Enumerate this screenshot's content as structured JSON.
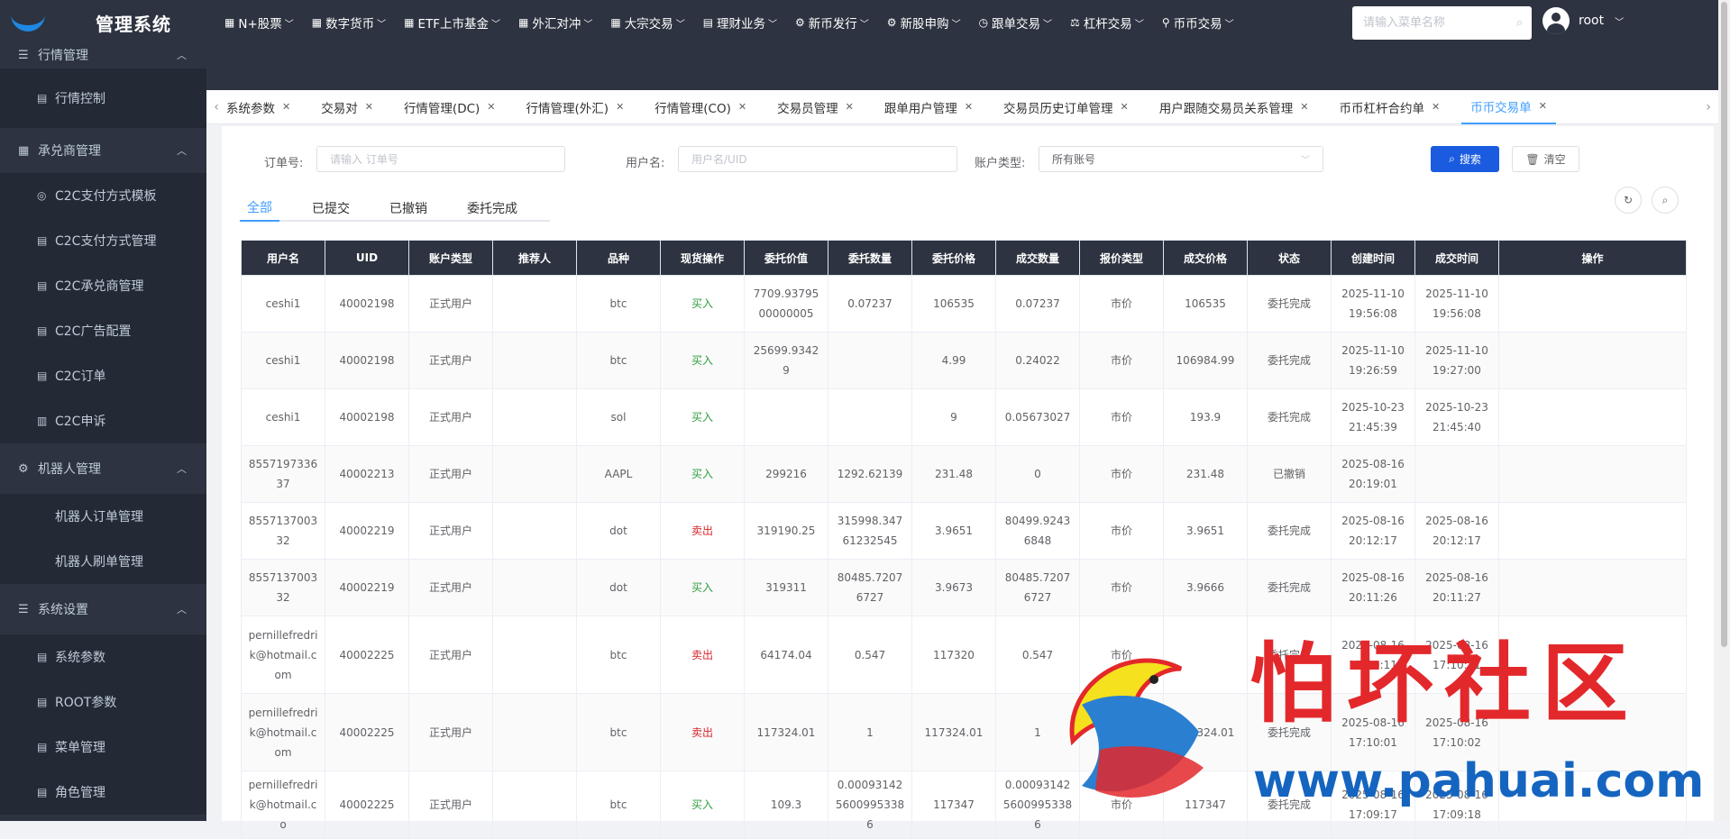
{
  "app": {
    "title": "管理系统"
  },
  "sidebar": {
    "groups": [
      {
        "label": "行情管理",
        "icon": "list-icon",
        "items": [
          {
            "label": "行情控制",
            "icon": "doc-icon"
          }
        ]
      },
      {
        "label": "承兑商管理",
        "icon": "table-icon",
        "items": [
          {
            "label": "C2C支付方式模板",
            "icon": "circle-icon"
          },
          {
            "label": "C2C支付方式管理",
            "icon": "doc-icon"
          },
          {
            "label": "C2C承兑商管理",
            "icon": "doc-icon"
          },
          {
            "label": "C2C广告配置",
            "icon": "doc-icon"
          },
          {
            "label": "C2C订单",
            "icon": "doc-icon"
          },
          {
            "label": "C2C申诉",
            "icon": "chart-icon"
          }
        ]
      },
      {
        "label": "机器人管理",
        "icon": "gear-icon",
        "items": [
          {
            "label": "机器人订单管理",
            "icon": ""
          },
          {
            "label": "机器人刷单管理",
            "icon": ""
          }
        ]
      },
      {
        "label": "系统设置",
        "icon": "list-icon",
        "items": [
          {
            "label": "系统参数",
            "icon": "doc-icon"
          },
          {
            "label": "ROOT参数",
            "icon": "doc-icon"
          },
          {
            "label": "菜单管理",
            "icon": "doc-icon"
          },
          {
            "label": "角色管理",
            "icon": "doc-icon"
          }
        ]
      }
    ]
  },
  "topnav": {
    "items": [
      {
        "label": "N+股票",
        "icon": "grid-icon"
      },
      {
        "label": "数字货币",
        "icon": "grid-icon"
      },
      {
        "label": "ETF上市基金",
        "icon": "grid-icon"
      },
      {
        "label": "外汇对冲",
        "icon": "grid-icon"
      },
      {
        "label": "大宗交易",
        "icon": "grid-icon"
      },
      {
        "label": "理财业务",
        "icon": "table-icon"
      },
      {
        "label": "新币发行",
        "icon": "gear-icon"
      },
      {
        "label": "新股申购",
        "icon": "gear-icon"
      },
      {
        "label": "跟单交易",
        "icon": "clock-icon"
      },
      {
        "label": "杠杆交易",
        "icon": "scale-icon"
      },
      {
        "label": "币币交易",
        "icon": "pin-icon"
      }
    ],
    "search_placeholder": "请输入菜单名称",
    "user_name": "root"
  },
  "tabs": [
    {
      "label": "系统参数"
    },
    {
      "label": "交易对"
    },
    {
      "label": "行情管理(DC)"
    },
    {
      "label": "行情管理(外汇)"
    },
    {
      "label": "行情管理(CO)"
    },
    {
      "label": "交易员管理"
    },
    {
      "label": "跟单用户管理"
    },
    {
      "label": "交易员历史订单管理"
    },
    {
      "label": "用户跟随交易员关系管理"
    },
    {
      "label": "币币杠杆合约单"
    },
    {
      "label": "币币交易单",
      "active": true
    }
  ],
  "filters": {
    "order_label": "订单号:",
    "order_placeholder": "请输入 订单号",
    "user_label": "用户名:",
    "user_placeholder": "用户名/UID",
    "account_label": "账户类型:",
    "account_value": "所有账号",
    "search_button": "搜索",
    "clear_button": "清空"
  },
  "status_tabs": [
    {
      "label": "全部",
      "active": true
    },
    {
      "label": "已提交"
    },
    {
      "label": "已撤销"
    },
    {
      "label": "委托完成"
    }
  ],
  "table": {
    "headers": [
      "用户名",
      "UID",
      "账户类型",
      "推荐人",
      "品种",
      "现货操作",
      "委托价值",
      "委托数量",
      "委托价格",
      "成交数量",
      "报价类型",
      "成交价格",
      "状态",
      "创建时间",
      "成交时间",
      "操作"
    ],
    "rows": [
      [
        "ceshi1",
        "40002198",
        "正式用户",
        "",
        "btc",
        "买入",
        "7709.9379500000005",
        "0.07237",
        "106535",
        "0.07237",
        "市价",
        "106535",
        "委托完成",
        "2025-11-10 19:56:08",
        "2025-11-10 19:56:08",
        ""
      ],
      [
        "ceshi1",
        "40002198",
        "正式用户",
        "",
        "btc",
        "买入",
        "25699.93429",
        "",
        "4.99",
        "0.24022",
        "市价",
        "106984.99",
        "委托完成",
        "2025-11-10 19:26:59",
        "2025-11-10 19:27:00",
        ""
      ],
      [
        "ceshi1",
        "40002198",
        "正式用户",
        "",
        "sol",
        "买入",
        "",
        "",
        "9",
        "0.05673027",
        "市价",
        "193.9",
        "委托完成",
        "2025-10-23 21:45:39",
        "2025-10-23 21:45:40",
        ""
      ],
      [
        "855719733637",
        "40002213",
        "正式用户",
        "",
        "AAPL",
        "买入",
        "299216",
        "1292.62139",
        "231.48",
        "0",
        "市价",
        "231.48",
        "已撤销",
        "2025-08-16 20:19:01",
        "",
        ""
      ],
      [
        "855713700332",
        "40002219",
        "正式用户",
        "",
        "dot",
        "卖出",
        "319190.25",
        "315998.34761232545",
        "3.9651",
        "80499.92436848",
        "市价",
        "3.9651",
        "委托完成",
        "2025-08-16 20:12:17",
        "2025-08-16 20:12:17",
        ""
      ],
      [
        "855713700332",
        "40002219",
        "正式用户",
        "",
        "dot",
        "买入",
        "319311",
        "80485.72076727",
        "3.9673",
        "80485.72076727",
        "市价",
        "3.9666",
        "委托完成",
        "2025-08-16 20:11:26",
        "2025-08-16 20:11:27",
        ""
      ],
      [
        "pernillefredrik@hotmail.com",
        "40002225",
        "正式用户",
        "",
        "btc",
        "卖出",
        "64174.04",
        "0.547",
        "117320",
        "0.547",
        "市价",
        "",
        "委托完成",
        "2025-08-16 17:10:11",
        "2025-08-16 17:10:11",
        ""
      ],
      [
        "pernillefredrik@hotmail.com",
        "40002225",
        "正式用户",
        "",
        "btc",
        "卖出",
        "117324.01",
        "1",
        "117324.01",
        "1",
        "市价",
        "117324.01",
        "委托完成",
        "2025-08-16 17:10:01",
        "2025-08-16 17:10:02",
        ""
      ],
      [
        "pernillefredrik@hotmail.co",
        "40002225",
        "正式用户",
        "",
        "btc",
        "买入",
        "109.3",
        "0.0009314256009953386",
        "117347",
        "0.0009314256009953386",
        "市价",
        "117347",
        "委托完成",
        "2025-08-16 17:09:17",
        "2025-08-16 17:09:18",
        ""
      ]
    ]
  },
  "watermark": {
    "title": "怕坏社区",
    "url": "www.pahuai.com"
  },
  "colors": {
    "sidebar_bg": "#2d3340",
    "primary": "#1a5be0",
    "tab_active": "#409eff",
    "buy": "#2e9e3e",
    "sell": "#d9262c"
  }
}
